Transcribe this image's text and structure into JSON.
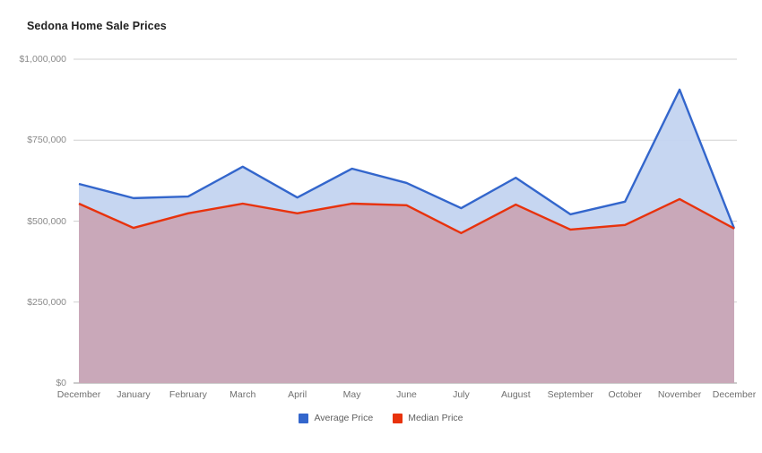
{
  "chart_data": {
    "type": "area",
    "title": "Sedona Home Sale Prices",
    "xlabel": "",
    "ylabel": "",
    "grid": true,
    "legend_position": "bottom",
    "ylim": [
      0,
      1000000
    ],
    "ytick_labels": [
      "$1,000,000",
      "$750,000",
      "$500,000",
      "$250,000",
      "$0"
    ],
    "ytick_values": [
      1000000,
      750000,
      500000,
      250000,
      0
    ],
    "categories": [
      "December",
      "January",
      "February",
      "March",
      "April",
      "May",
      "June",
      "July",
      "August",
      "September",
      "October",
      "November",
      "December"
    ],
    "series": [
      {
        "name": "Average Price",
        "color": "#3366cc",
        "fill": "#c3d4f0",
        "values": [
          615000,
          571000,
          576000,
          668000,
          573000,
          662000,
          618000,
          540000,
          634000,
          521000,
          560000,
          906000,
          477000
        ]
      },
      {
        "name": "Median Price",
        "color": "#e8320c",
        "fill": "#c9a2b0",
        "values": [
          554000,
          479000,
          524000,
          554000,
          524000,
          554000,
          549000,
          463000,
          551000,
          474000,
          488000,
          568000,
          477000
        ]
      }
    ]
  },
  "legend": {
    "items": [
      {
        "label": "Average Price",
        "color": "#3366cc"
      },
      {
        "label": "Median Price",
        "color": "#e8320c"
      }
    ]
  },
  "colors": {
    "average_line": "#3366cc",
    "average_fill": "#c3d4f0",
    "median_line": "#e8320c",
    "median_fill": "#c9a2b0",
    "gridline": "#d0d0d0",
    "axis_text": "#8a8a8a",
    "title_text": "#222222",
    "background": "#ffffff"
  }
}
